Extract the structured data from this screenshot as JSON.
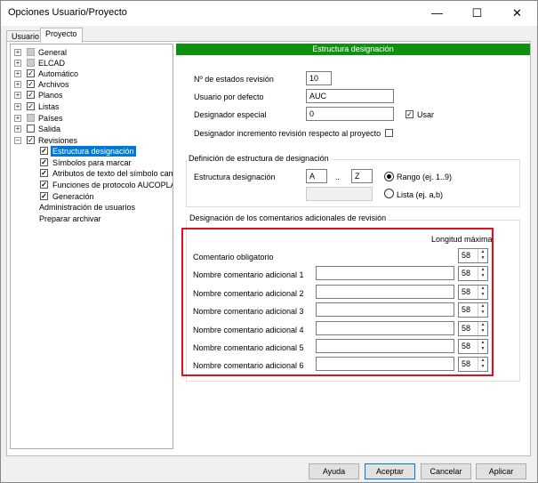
{
  "window": {
    "title": "Opciones Usuario/Proyecto",
    "minimize": "—",
    "maximize": "☐",
    "close": "✕"
  },
  "tabs": [
    {
      "label": "Usuario"
    },
    {
      "label": "Proyecto"
    }
  ],
  "tree": {
    "items": [
      {
        "label": "General",
        "expander": "+",
        "check": ""
      },
      {
        "label": "ELCAD",
        "expander": "+",
        "check": ""
      },
      {
        "label": "Automático",
        "expander": "+",
        "check": "✓"
      },
      {
        "label": "Archivos",
        "expander": "+",
        "check": "✓"
      },
      {
        "label": "Planos",
        "expander": "+",
        "check": "✓"
      },
      {
        "label": "Listas",
        "expander": "+",
        "check": "✓"
      },
      {
        "label": "Países",
        "expander": "+",
        "check": ""
      },
      {
        "label": "Salida",
        "expander": "+",
        "check": ""
      },
      {
        "label": "Revisiones",
        "expander": "−",
        "check": "✓"
      },
      {
        "label": "Estructura designación",
        "check": "✓",
        "selected": true
      },
      {
        "label": "Símbolos para marcar",
        "check": "✓"
      },
      {
        "label": "Atributos de texto del símbolo cambia",
        "check": "✓"
      },
      {
        "label": "Funciones de protocolo AUCOPLAN",
        "check": "✓"
      },
      {
        "label": "Generación",
        "check": "✓"
      },
      {
        "label": "Administración de usuarios"
      },
      {
        "label": "Preparar archivar"
      }
    ]
  },
  "panel": {
    "header": "Estructura designación",
    "num_estados_label": "Nº de estados revisión",
    "num_estados_value": "10",
    "usuario_label": "Usuario por defecto",
    "usuario_value": "AUC",
    "designador_label": "Designador especial",
    "designador_value": "0",
    "usar_label": "Usar",
    "usar_check": "✓",
    "incremento_label": "Designador incremento revisión respecto al proyecto",
    "incremento_check": ""
  },
  "estructura": {
    "group_title": "Definición de estructura de designación",
    "label": "Estructura designación",
    "from": "A",
    "dots": "..",
    "to": "Z",
    "rango_label": "Rango (ej. 1..9)",
    "lista_label": "Lista (ej. a,b)"
  },
  "comentarios": {
    "group_title": "Designación de los comentarios adicionales de revisión",
    "longitud_header": "Longitud máxima",
    "obligatorio_label": "Comentario obligatorio",
    "obligatorio_value": "58",
    "rows": [
      {
        "label": "Nombre comentario adicional 1",
        "value": "",
        "length": "58"
      },
      {
        "label": "Nombre comentario adicional 2",
        "value": "",
        "length": "58"
      },
      {
        "label": "Nombre comentario adicional 3",
        "value": "",
        "length": "58"
      },
      {
        "label": "Nombre comentario adicional 4",
        "value": "",
        "length": "58"
      },
      {
        "label": "Nombre comentario adicional 5",
        "value": "",
        "length": "58"
      },
      {
        "label": "Nombre comentario adicional 6",
        "value": "",
        "length": "58"
      }
    ]
  },
  "buttons": {
    "ayuda": "Ayuda",
    "aceptar": "Aceptar",
    "cancelar": "Cancelar",
    "aplicar": "Aplicar"
  },
  "colors": {
    "header_bg": "#109010",
    "highlight_box": "#e01020",
    "selection": "#0078d7"
  }
}
